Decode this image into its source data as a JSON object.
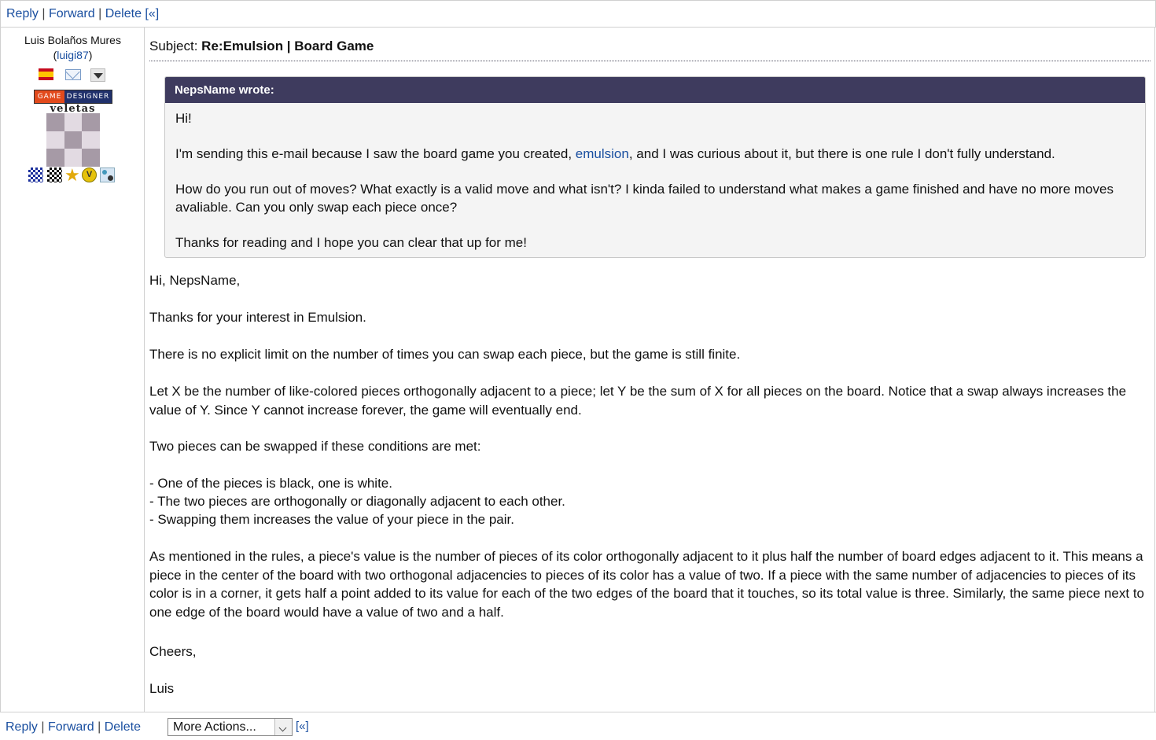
{
  "toolbar_top": {
    "reply": "Reply",
    "forward": "Forward",
    "delete": "Delete",
    "separator": "|",
    "collapse": "[«]"
  },
  "sender": {
    "name": "Luis Bolaños Mures",
    "handle": "luigi87",
    "badge_left": "GAME",
    "badge_right": "DESIGNER",
    "avatar_caption": "veletas",
    "icons": [
      "spain-flag-icon",
      "mail-icon",
      "dropdown-icon"
    ],
    "badge_icons": [
      "blue-checker-badge-icon",
      "black-checker-badge-icon",
      "star-badge-icon",
      "v-medal-badge-icon",
      "go-stones-badge-icon"
    ]
  },
  "message": {
    "subject_label": "Subject:",
    "subject_value": "Re:Emulsion | Board Game",
    "quote_author": "NepsName wrote:",
    "quote": {
      "p1": "Hi!",
      "p2_before": "I'm sending this e-mail because I saw the board game you created, ",
      "p2_link": "emulsion",
      "p2_after": ", and I was curious about it, but there is one rule I don't fully understand.",
      "p3": "How do you run out of moves? What exactly is a valid move and what isn't? I kinda failed to understand what makes a game finished and have no more moves avaliable. Can you only swap each piece once?",
      "p4": "Thanks for reading and I hope you can clear that up for me!"
    },
    "reply": {
      "greeting": "Hi, NepsName,",
      "p1": "Thanks for your interest in Emulsion.",
      "p2": "There is no explicit limit on the number of times you can swap each piece, but the game is still finite.",
      "p3": "Let X be the number of like-colored pieces orthogonally adjacent to a piece; let Y be the sum of X for all pieces on the board. Notice that a swap always increases the value of Y. Since Y cannot increase forever, the game will eventually end.",
      "p4": "Two pieces can be swapped if these conditions are met:",
      "b1": "- One of the pieces is black, one is white.",
      "b2": "- The two pieces are orthogonally or diagonally adjacent to each other.",
      "b3": "- Swapping them increases the value of your piece in the pair.",
      "p5": "As mentioned in the rules, a piece's value is the number of pieces of its color orthogonally adjacent to it plus half the number of board edges adjacent to it. This means a piece in the center of the board with two orthogonal adjacencies to pieces of its color has a value of two. If a piece with the same number of adjacencies to pieces of its color is in a corner, it gets half a point added to its value for each of the two edges of the board that it touches, so its total value is three. Similarly, the same piece next to one edge of the board would have a value of two and a half.",
      "closing": "Cheers,",
      "signature": "Luis"
    }
  },
  "toolbar_bottom": {
    "reply": "Reply",
    "forward": "Forward",
    "delete": "Delete",
    "separator": "|",
    "more_actions": "More Actions...",
    "collapse": "[«]"
  }
}
